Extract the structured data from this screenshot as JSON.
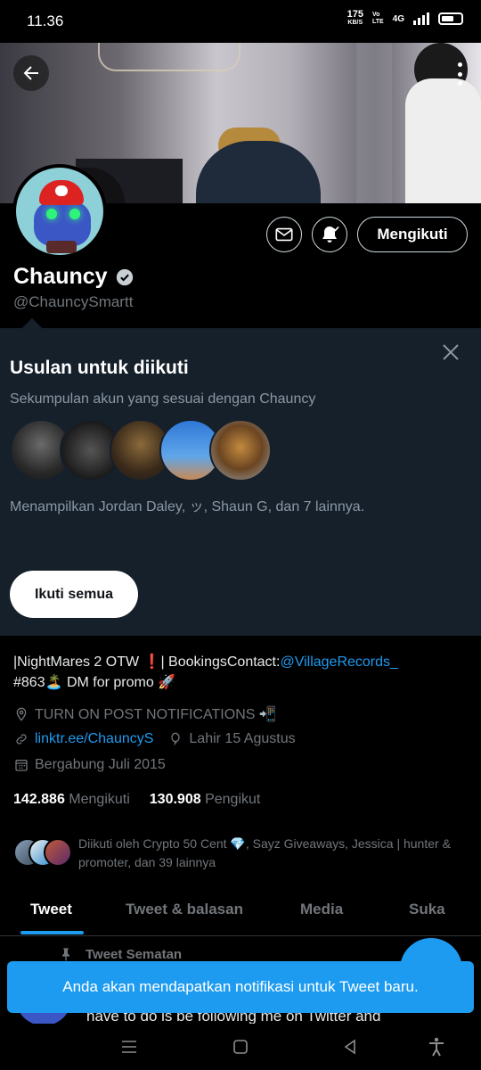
{
  "status_bar": {
    "time": "11.36",
    "net_speed": "175",
    "net_unit": "KB/S",
    "volte_top": "Vo",
    "volte_bottom": "LTE",
    "network": "4G"
  },
  "banner": {
    "back_icon": "arrow-left-icon",
    "more_icon": "more-vertical-icon"
  },
  "profile": {
    "name": "Chauncy",
    "verified_icon": "verified-badge-icon",
    "handle": "@ChauncySmartt",
    "follow_button": "Mengikuti",
    "mail_icon": "mail-icon",
    "bell_icon": "bell-icon"
  },
  "suggestions": {
    "title": "Usulan untuk diikuti",
    "subtitle": "Sekumpulan akun yang sesuai dengan Chauncy",
    "shown_text": "Menampilkan Jordan Daley, ッ, Shaun G, dan 7 lainnya.",
    "follow_all": "Ikuti semua",
    "close_icon": "close-icon"
  },
  "bio": {
    "part1": "|NightMares 2 OTW ❗| BookingsContact:",
    "mention": "@VillageRecords_",
    "part2": "#863🏝️ DM for promo 🚀"
  },
  "meta": {
    "location": "TURN ON POST NOTIFICATIONS 📲",
    "website": "linktr.ee/ChauncyS",
    "birthday": "Lahir 15 Agustus",
    "joined": "Bergabung Juli 2015"
  },
  "counts": {
    "following_num": "142.886",
    "following_label": "Mengikuti",
    "followers_num": "130.908",
    "followers_label": "Pengikut"
  },
  "followed_by": "Diikuti oleh Crypto 50 Cent 💎, Sayz Giveaways, Jessica | hunter & promoter, dan 39 lainnya",
  "tabs": [
    "Tweet",
    "Tweet & balasan",
    "Media",
    "Suka"
  ],
  "pinned_label": "Tweet Sematan",
  "tweet_partial": "have to do is be following me on Twitter and",
  "toast": "Anda akan mendapatkan notifikasi untuk Tweet baru.",
  "colors": {
    "accent": "#1d9bf0",
    "panel": "#15202b",
    "muted": "#71767b"
  }
}
